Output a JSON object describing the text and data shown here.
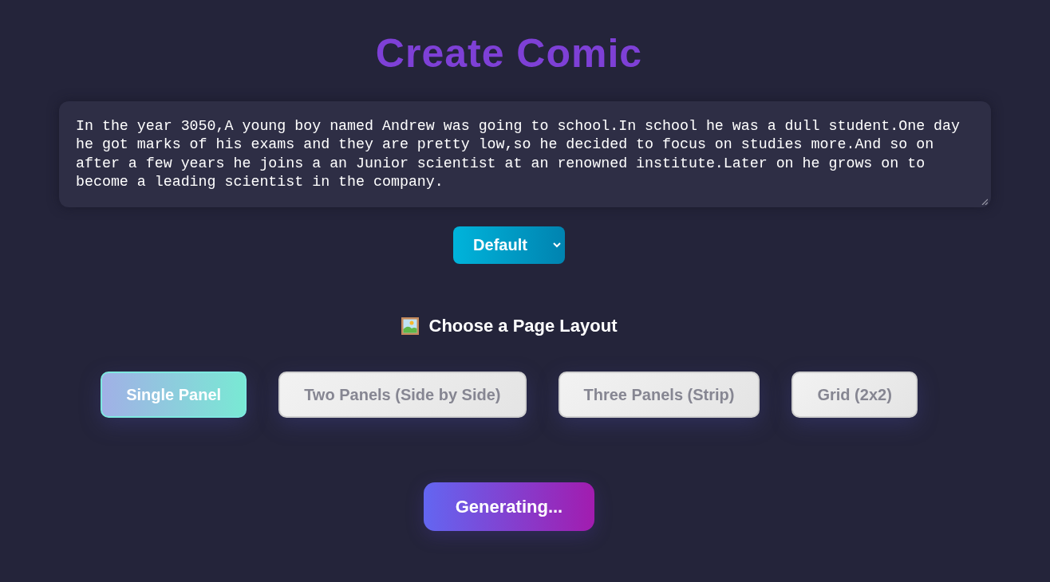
{
  "title": "Create Comic",
  "story": {
    "value": "In the year 3050,A young boy named Andrew was going to school.In school he was a dull student.One day he got marks of his exams and they are pretty low,so he decided to focus on studies more.And so on after a few years he joins a an Junior scientist at an renowned institute.Later on he grows on to become a leading scientist in the company."
  },
  "style_select": {
    "value": "Default"
  },
  "layout_section": {
    "heading": "Choose a Page Layout",
    "options": [
      {
        "label": "Single Panel",
        "selected": true
      },
      {
        "label": "Two Panels (Side by Side)",
        "selected": false
      },
      {
        "label": "Three Panels (Strip)",
        "selected": false
      },
      {
        "label": "Grid (2x2)",
        "selected": false
      }
    ]
  },
  "generate_button": {
    "label": "Generating..."
  }
}
